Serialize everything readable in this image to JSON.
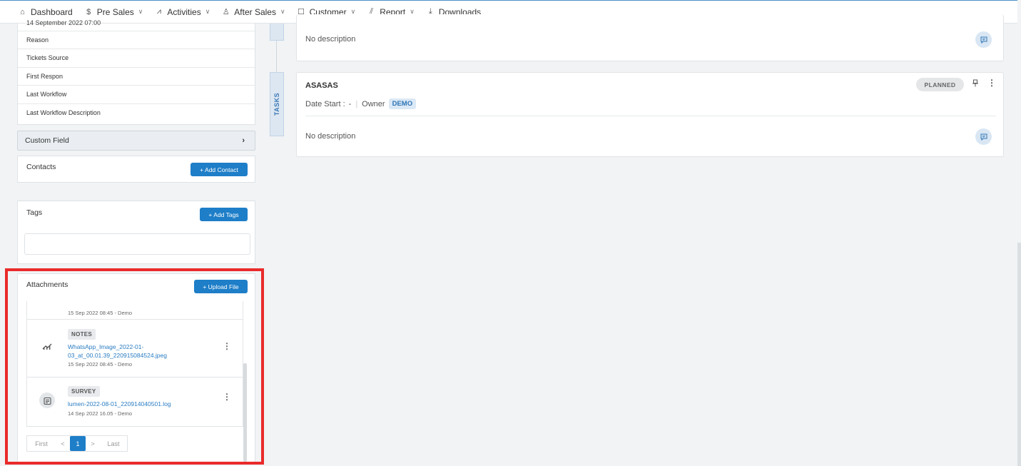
{
  "nav": {
    "items": [
      {
        "icon": "home-icon",
        "glyph": "⌂",
        "label": "Dashboard",
        "dropdown": false
      },
      {
        "icon": "dollar-icon",
        "glyph": "$",
        "label": "Pre Sales",
        "dropdown": true
      },
      {
        "icon": "activity-icon",
        "glyph": "⩘",
        "label": "Activities",
        "dropdown": true
      },
      {
        "icon": "users-icon",
        "glyph": "♙",
        "label": "After Sales",
        "dropdown": true
      },
      {
        "icon": "customer-icon",
        "glyph": "☐",
        "label": "Customer",
        "dropdown": true
      },
      {
        "icon": "report-icon",
        "glyph": "⫽",
        "label": "Report",
        "dropdown": true
      },
      {
        "icon": "download-icon",
        "glyph": "⤓",
        "label": "Downloads",
        "dropdown": false
      }
    ]
  },
  "info": {
    "date": "14 September 2022 07:00",
    "rows": [
      "Reason",
      "Tickets Source",
      "First Respon",
      "Last Workflow",
      "Last Workflow Description"
    ]
  },
  "custom_field": {
    "label": "Custom Field"
  },
  "contacts": {
    "title": "Contacts",
    "button": "+ Add Contact"
  },
  "tags": {
    "title": "Tags",
    "button": "+ Add Tags"
  },
  "attachments": {
    "title": "Attachments",
    "button": "+ Upload File",
    "items": [
      {
        "badge": "",
        "filename": "",
        "meta": "15 Sep 2022 08:45  -  Demo"
      },
      {
        "badge": "NOTES",
        "filename": "WhatsApp_Image_2022-01-03_at_00.01.39_220915084524.jpeg",
        "meta": "15 Sep 2022 08:45  -  Demo",
        "icon": "chart-icon"
      },
      {
        "badge": "SURVEY",
        "filename": "lumen-2022-08-01_220914040501.log",
        "meta": "14 Sep 2022 16.05  -  Demo",
        "icon": "calendar-icon"
      }
    ],
    "pager": {
      "first": "First",
      "prev": "<",
      "current": "1",
      "next": ">",
      "last": "Last"
    }
  },
  "timeline": {
    "tab_label": "TASKS",
    "card1": {
      "description": "No description"
    },
    "card2": {
      "title": "ASASAS",
      "date_start_label": "Date Start :",
      "date_start_value": "-",
      "owner_label": "Owner",
      "owner_value": "DEMO",
      "status": "PLANNED",
      "description": "No description"
    }
  }
}
